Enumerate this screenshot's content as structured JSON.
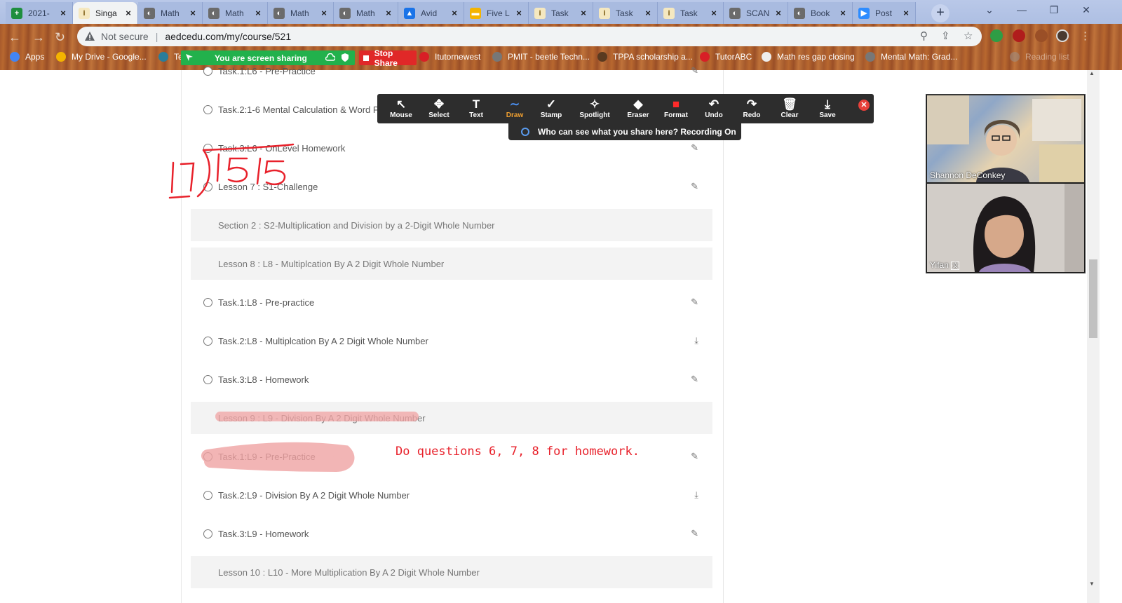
{
  "browser": {
    "tabs": [
      {
        "label": "2021-",
        "favicon_color": "#1e8e3e",
        "favicon_glyph": "+"
      },
      {
        "label": "Singa",
        "favicon_color": "#f5e8c0",
        "favicon_glyph": "i",
        "active": true
      },
      {
        "label": "Math",
        "favicon_color": "#6b6b6b",
        "favicon_glyph": "◐"
      },
      {
        "label": "Math",
        "favicon_color": "#6b6b6b",
        "favicon_glyph": "◐"
      },
      {
        "label": "Math",
        "favicon_color": "#6b6b6b",
        "favicon_glyph": "◐"
      },
      {
        "label": "Math",
        "favicon_color": "#6b6b6b",
        "favicon_glyph": "◐"
      },
      {
        "label": "Avid",
        "favicon_color": "#1a73e8",
        "favicon_glyph": "▲"
      },
      {
        "label": "Five L",
        "favicon_color": "#f4b400",
        "favicon_glyph": "▬"
      },
      {
        "label": "Task",
        "favicon_color": "#f5e8c0",
        "favicon_glyph": "i"
      },
      {
        "label": "Task",
        "favicon_color": "#f5e8c0",
        "favicon_glyph": "i"
      },
      {
        "label": "Task",
        "favicon_color": "#f5e8c0",
        "favicon_glyph": "i"
      },
      {
        "label": "SCAN",
        "favicon_color": "#6b6b6b",
        "favicon_glyph": "◐"
      },
      {
        "label": "Book",
        "favicon_color": "#6b6b6b",
        "favicon_glyph": "◐"
      },
      {
        "label": "Post",
        "favicon_color": "#2d8cff",
        "favicon_glyph": "▶"
      }
    ],
    "security_label": "Not secure",
    "url": "aedcedu.com/my/course/521",
    "bookmarks": [
      "Apps",
      "My Drive - Google...",
      "Te",
      "Itutornewest",
      "PMIT - beetle Techn...",
      "TPPA scholarship a...",
      "TutorABC",
      "Math res gap closing",
      "Mental Math: Grad...",
      "Reading list"
    ]
  },
  "screen_share": {
    "status": "You are screen sharing",
    "stop_label": "Stop Share"
  },
  "annotation_toolbar": {
    "tools": [
      "Mouse",
      "Select",
      "Text",
      "Draw",
      "Stamp",
      "Spotlight",
      "Eraser",
      "Format",
      "Undo",
      "Redo",
      "Clear",
      "Save"
    ],
    "active_tool": "Draw",
    "notice": "Who can see what you share here? Recording On"
  },
  "course_list": {
    "rows": [
      {
        "type": "task",
        "label": "Task.1:L6 - Pre-Practice",
        "action": "edit"
      },
      {
        "type": "task",
        "label": "Task.2:1-6 Mental Calculation & Word Pro",
        "action": "edit"
      },
      {
        "type": "task",
        "label": "Task.3:L6 - OnLevel Homework",
        "action": "edit"
      },
      {
        "type": "task",
        "label": "Lesson 7 : S1-Challenge",
        "action": "edit"
      },
      {
        "type": "header",
        "label": "Section 2 : S2-Multiplication and Division by a 2-Digit Whole Number"
      },
      {
        "type": "header",
        "label": "Lesson 8 : L8 - Multiplcation By A 2 Digit Whole Number"
      },
      {
        "type": "task",
        "label": "Task.1:L8 - Pre-practice",
        "action": "edit"
      },
      {
        "type": "task",
        "label": "Task.2:L8 - Multiplcation By A 2 Digit Whole Number",
        "action": "download"
      },
      {
        "type": "task",
        "label": "Task.3:L8 - Homework",
        "action": "edit"
      },
      {
        "type": "header",
        "label": "Lesson 9 : L9 - Division By A 2 Digit Whole Number"
      },
      {
        "type": "task",
        "label": "Task.1:L9 - Pre-Practice",
        "action": "edit"
      },
      {
        "type": "task",
        "label": "Task.2:L9 - Division By A 2 Digit Whole Number",
        "action": "download"
      },
      {
        "type": "task",
        "label": "Task.3:L9 - Homework",
        "action": "edit"
      },
      {
        "type": "header",
        "label": "Lesson 10 : L10 - More Multiplication By A 2 Digit Whole Number"
      }
    ]
  },
  "annotations": {
    "handwritten_math": "17⟌515",
    "typed_note": "Do questions 6, 7, 8 for homework."
  },
  "participants": [
    {
      "name": "Shannon DeConkey"
    },
    {
      "name": "Yifan"
    }
  ]
}
